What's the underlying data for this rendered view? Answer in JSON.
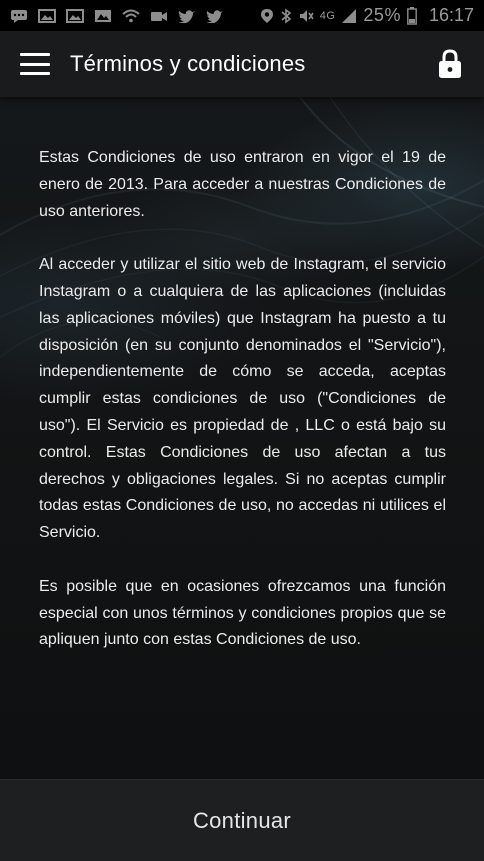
{
  "status_bar": {
    "battery": "25%",
    "time": "16:17",
    "network": "4G",
    "icons": [
      "message-icon",
      "image-icon",
      "image-icon",
      "photo-icon",
      "wifi-icon",
      "video-icon",
      "twitter-icon",
      "twitter-icon",
      "location-icon",
      "bluetooth-icon",
      "mute-icon",
      "signal-icon",
      "battery-icon"
    ]
  },
  "app_bar": {
    "title": "Términos y condiciones",
    "menu_icon": "hamburger-menu-icon",
    "lock_icon": "lock-icon"
  },
  "content": {
    "paragraphs": [
      "Estas Condiciones de uso entraron en vigor el 19 de enero de 2013. Para acceder a nuestras Condiciones de uso anteriores.",
      "Al acceder y utilizar el sitio web de Instagram, el servicio Instagram o a cualquiera de las aplicaciones (incluidas las aplicaciones móviles) que Instagram ha puesto a tu disposición (en su conjunto denominados el \"Servicio\"), independientemente de cómo se acceda, aceptas cumplir estas condiciones de uso (\"Condiciones de uso\"). El Servicio es propiedad de , LLC  o está bajo su control. Estas Condiciones de uso afectan a tus derechos y obligaciones legales. Si no aceptas cumplir todas estas Condiciones de uso, no accedas ni utilices el Servicio.",
      "Es posible que en ocasiones ofrezcamos una función especial con unos términos y condiciones propios que se apliquen junto con estas Condiciones de uso."
    ]
  },
  "footer": {
    "continue_label": "Continuar"
  },
  "colors": {
    "status_bar_bg": "#000000",
    "app_bar_bg": "#1a1b1c",
    "content_bg": "#121415",
    "text": "#ececec",
    "bottom_bar_bg": "#1e1f20"
  }
}
